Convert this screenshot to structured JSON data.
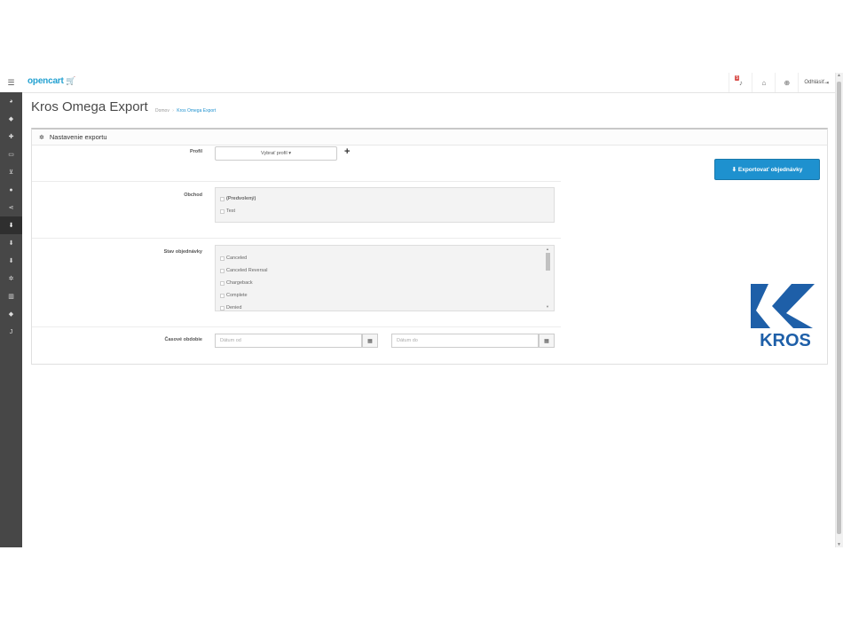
{
  "header": {
    "logo_text": "opencart",
    "logo_cart": "🛒",
    "notification_count": "5",
    "logout_label": "Odhlásiť",
    "icons": [
      "bars-icon",
      "bell-icon",
      "home-icon",
      "support-icon",
      "sign-out-icon"
    ]
  },
  "sidebar": {
    "items": [
      {
        "icon": "dashboard-icon",
        "glyph": "◕"
      },
      {
        "icon": "tag-icon",
        "glyph": "◆"
      },
      {
        "icon": "puzzle-icon",
        "glyph": "✚"
      },
      {
        "icon": "desktop-icon",
        "glyph": "▭"
      },
      {
        "icon": "shopping-cart-icon",
        "glyph": "⊻"
      },
      {
        "icon": "user-icon",
        "glyph": "●"
      },
      {
        "icon": "share-icon",
        "glyph": "⋖"
      },
      {
        "icon": "download-icon",
        "glyph": "⬇"
      },
      {
        "icon": "download-icon",
        "glyph": "⬇"
      },
      {
        "icon": "download-icon",
        "glyph": "⬇"
      },
      {
        "icon": "cog-icon",
        "glyph": "✲"
      },
      {
        "icon": "bar-chart-icon",
        "glyph": "▥"
      },
      {
        "icon": "tags-icon",
        "glyph": "◆"
      },
      {
        "icon": "j-icon",
        "glyph": "J"
      }
    ],
    "active_index": 7
  },
  "page": {
    "title": "Kros Omega Export",
    "breadcrumb": {
      "home": "Domov",
      "separator": "›",
      "current": "Kros Omega Export"
    }
  },
  "panel": {
    "heading": "Nastavenie exportu",
    "profile": {
      "label": "Profil",
      "select_text": "Vybrať profil ▾",
      "add_symbol": "+"
    },
    "store": {
      "label": "Obchod",
      "options": [
        {
          "label": "(Predvolený)",
          "bold": true
        },
        {
          "label": "Test",
          "bold": false
        }
      ]
    },
    "status": {
      "label": "Stav objednávky",
      "options": [
        "Canceled",
        "Canceled Reversal",
        "Chargeback",
        "Complete",
        "Denied"
      ]
    },
    "period": {
      "label": "Časové obdobie",
      "from_placeholder": "Dátum od",
      "to_placeholder": "Dátum do",
      "calendar_glyph": "▦"
    },
    "export_button": "⬇ Exportovať objednávky"
  },
  "brand": {
    "text": "KROS",
    "color": "#1e5fa8"
  },
  "colors": {
    "accent": "#1e91cf",
    "sidebar": "#474747",
    "badge": "#d9534f"
  }
}
